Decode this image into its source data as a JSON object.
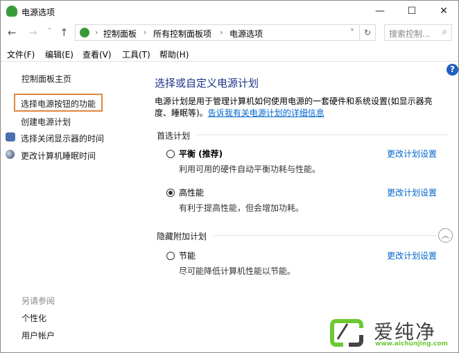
{
  "window": {
    "title": "电源选项",
    "minimize": "—",
    "maximize": "☐",
    "close": "✕"
  },
  "nav": {
    "back": "←",
    "forward": "→",
    "recent": "˅",
    "up": "↑",
    "refresh": "↻",
    "dropdown": "˅"
  },
  "breadcrumb": [
    "控制面板",
    "所有控制面板项",
    "电源选项"
  ],
  "search": {
    "placeholder": "搜索控制...",
    "icon": "⌕"
  },
  "menu": [
    "文件(F)",
    "编辑(E)",
    "查看(V)",
    "工具(T)",
    "帮助(H)"
  ],
  "left": {
    "home": "控制面板主页",
    "items": [
      "选择电源按钮的功能",
      "创建电源计划",
      "选择关闭显示器的时间",
      "更改计算机睡眠时间"
    ],
    "see_also": "另请参阅",
    "see_also_items": [
      "个性化",
      "用户帐户"
    ]
  },
  "main": {
    "title": "选择或自定义电源计划",
    "desc": "电源计划是用于管理计算机如何使用电源的一套硬件和系统设置(如显示器亮度、睡眠等)。",
    "desc_link": "告诉我有关电源计划的详细信息",
    "preferred": "首选计划",
    "hidden": "隐藏附加计划",
    "plans": [
      {
        "name": "平衡 (推荐)",
        "desc": "利用可用的硬件自动平衡功耗与性能。",
        "change": "更改计划设置",
        "selected": false
      },
      {
        "name": "高性能",
        "desc": "有利于提高性能，但会增加功耗。",
        "change": "更改计划设置",
        "selected": true
      },
      {
        "name": "节能",
        "desc": "尽可能降低计算机性能以节能。",
        "change": "更改计划设置",
        "selected": false
      }
    ],
    "help": "?",
    "collapse": "︿"
  },
  "watermark": {
    "brand": "爱纯净",
    "url": "www.aichunjing.com"
  },
  "colors": {
    "accent": "#0066cc",
    "highlight_border": "#e0873a",
    "title": "#1e3287"
  }
}
